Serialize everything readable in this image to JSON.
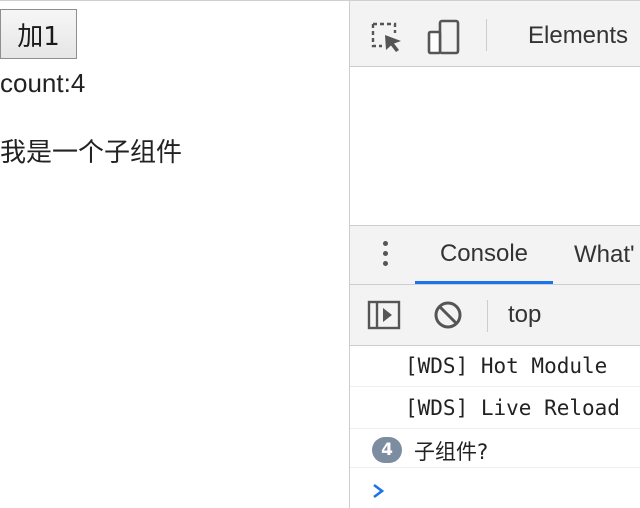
{
  "page": {
    "add_button_label": "加1",
    "count_text": "count:4",
    "child_text": "我是一个子组件"
  },
  "devtools": {
    "tabs": {
      "elements_label": "Elements"
    },
    "drawer": {
      "console_tab_label": "Console",
      "whats_new_tab_label": "What'"
    },
    "console_toolbar": {
      "context_label": "top"
    },
    "messages": [
      {
        "text": "[WDS] Hot Module"
      },
      {
        "text": "[WDS] Live Reload"
      },
      {
        "count": "4",
        "text": "子组件?"
      }
    ],
    "icons": {
      "inspect": "inspect-element-icon",
      "device": "device-toolbar-icon",
      "menu": "more-vertical-icon",
      "sidebar": "console-sidebar-icon",
      "clear": "clear-console-icon",
      "prompt": "chevron-right-icon"
    },
    "colors": {
      "active_tab_underline": "#1a73e8",
      "badge": "#7d8da1",
      "prompt": "#1a73e8"
    }
  }
}
